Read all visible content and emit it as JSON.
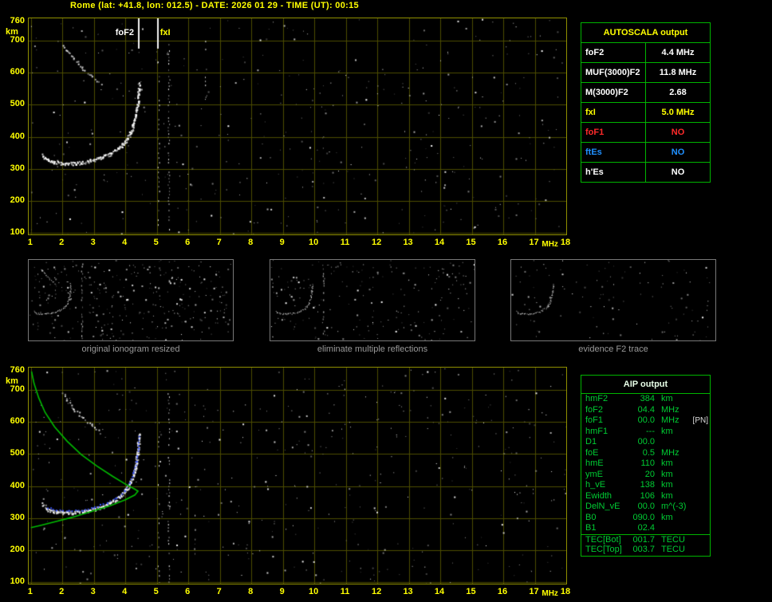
{
  "header": {
    "title": "Rome (lat: +41.8, lon: 012.5) - DATE: 2026 01 29 - TIME (UT): 00:15"
  },
  "autoscala": {
    "title": "AUTOSCALA output",
    "rows": [
      {
        "param": "foF2",
        "value": "4.4 MHz",
        "color": "#ffffff"
      },
      {
        "param": "MUF(3000)F2",
        "value": "11.8 MHz",
        "color": "#ffffff"
      },
      {
        "param": "M(3000)F2",
        "value": "2.68",
        "color": "#ffffff"
      },
      {
        "param": "fxI",
        "value": "5.0 MHz",
        "color": "#ffff00"
      },
      {
        "param": "foF1",
        "value": "NO",
        "color": "#ff2a2a"
      },
      {
        "param": "ftEs",
        "value": "NO",
        "color": "#2090ff"
      },
      {
        "param": "h'Es",
        "value": "NO",
        "color": "#ffffff"
      }
    ]
  },
  "panels": [
    {
      "caption": "original ionogram resized"
    },
    {
      "caption": "eliminate multiple reflections"
    },
    {
      "caption": "evidence F2 trace"
    }
  ],
  "aip": {
    "title": "AIP output",
    "rows": [
      {
        "param": "hmF2",
        "value": "384",
        "unit": "km",
        "note": ""
      },
      {
        "param": "foF2",
        "value": "04.4",
        "unit": "MHz",
        "note": ""
      },
      {
        "param": "foF1",
        "value": "00.0",
        "unit": "MHz",
        "note": "[PN]"
      },
      {
        "param": "hmF1",
        "value": "---",
        "unit": "km",
        "note": ""
      },
      {
        "param": "D1",
        "value": "00.0",
        "unit": "",
        "note": ""
      },
      {
        "param": "foE",
        "value": "0.5",
        "unit": "MHz",
        "note": ""
      },
      {
        "param": "hmE",
        "value": "110",
        "unit": "km",
        "note": ""
      },
      {
        "param": "ymE",
        "value": "20",
        "unit": "km",
        "note": ""
      },
      {
        "param": "h_vE",
        "value": "138",
        "unit": "km",
        "note": ""
      },
      {
        "param": "Ewidth",
        "value": "106",
        "unit": "km",
        "note": ""
      },
      {
        "param": "DelN_vE",
        "value": "00.0",
        "unit": "m^(-3)",
        "note": ""
      },
      {
        "param": "B0",
        "value": "090.0",
        "unit": "km",
        "note": ""
      },
      {
        "param": "B1",
        "value": "02.4",
        "unit": "",
        "note": ""
      },
      {
        "param": "TEC[Bot]",
        "value": "001.7",
        "unit": "TECU",
        "note": "",
        "sep": true
      },
      {
        "param": "TEC[Top]",
        "value": "003.7",
        "unit": "TECU",
        "note": ""
      }
    ]
  },
  "chart_data": [
    {
      "type": "scatter",
      "name": "autoscaled ionogram",
      "title": "",
      "xlabel": "MHz",
      "ylabel": "km",
      "xlim": [
        1,
        18
      ],
      "ylim": [
        100,
        760
      ],
      "x_ticks": [
        1,
        2,
        3,
        4,
        5,
        6,
        7,
        8,
        9,
        10,
        11,
        12,
        13,
        14,
        15,
        16,
        17,
        18
      ],
      "y_ticks": [
        760,
        700,
        600,
        500,
        400,
        300,
        200,
        100
      ],
      "grid": true,
      "legend": "none",
      "markers": [
        {
          "label": "foF2",
          "freq_mhz": 4.4,
          "color": "#ffffff"
        },
        {
          "label": "fxI",
          "freq_mhz": 5.0,
          "color": "#ffff00"
        }
      ],
      "series": [
        {
          "name": "F2 trace",
          "style": "dots",
          "color": "#ffffff",
          "points": [
            [
              1.35,
              345
            ],
            [
              1.5,
              330
            ],
            [
              1.7,
              322
            ],
            [
              2.0,
              318
            ],
            [
              2.4,
              318
            ],
            [
              2.8,
              324
            ],
            [
              3.2,
              334
            ],
            [
              3.5,
              348
            ],
            [
              3.8,
              366
            ],
            [
              4.0,
              388
            ],
            [
              4.15,
              412
            ],
            [
              4.25,
              440
            ],
            [
              4.33,
              472
            ],
            [
              4.38,
              510
            ],
            [
              4.41,
              548
            ],
            [
              4.42,
              565
            ]
          ]
        },
        {
          "name": "second reflection",
          "style": "dots-faint",
          "color": "#e8e8e8",
          "points": [
            [
              2.0,
              690
            ],
            [
              2.15,
              668
            ],
            [
              2.35,
              644
            ],
            [
              2.6,
              618
            ],
            [
              2.9,
              592
            ],
            [
              3.2,
              568
            ]
          ]
        }
      ]
    },
    {
      "type": "scatter",
      "name": "ionogram with restored trace and electron density profile",
      "title": "",
      "xlabel": "MHz",
      "ylabel": "km",
      "xlim": [
        1,
        18
      ],
      "ylim": [
        100,
        760
      ],
      "x_ticks": [
        1,
        2,
        3,
        4,
        5,
        6,
        7,
        8,
        9,
        10,
        11,
        12,
        13,
        14,
        15,
        16,
        17,
        18
      ],
      "y_ticks": [
        760,
        700,
        600,
        500,
        400,
        300,
        200,
        100
      ],
      "grid": true,
      "legend": "none",
      "markers": [],
      "series": [
        {
          "name": "F2 trace",
          "style": "dots",
          "color": "#ffffff",
          "points": [
            [
              1.35,
              345
            ],
            [
              1.5,
              330
            ],
            [
              1.7,
              322
            ],
            [
              2.0,
              318
            ],
            [
              2.4,
              318
            ],
            [
              2.8,
              324
            ],
            [
              3.2,
              334
            ],
            [
              3.5,
              348
            ],
            [
              3.8,
              366
            ],
            [
              4.0,
              388
            ],
            [
              4.15,
              412
            ],
            [
              4.25,
              440
            ],
            [
              4.33,
              472
            ],
            [
              4.38,
              510
            ],
            [
              4.41,
              548
            ],
            [
              4.42,
              565
            ]
          ]
        },
        {
          "name": "second reflection",
          "style": "dots-faint",
          "color": "#e8e8e8",
          "points": [
            [
              2.0,
              690
            ],
            [
              2.15,
              668
            ],
            [
              2.35,
              644
            ],
            [
              2.6,
              618
            ],
            [
              2.9,
              592
            ],
            [
              3.2,
              568
            ]
          ]
        },
        {
          "name": "restored trace",
          "style": "dots-sparse",
          "color": "#3b55ff",
          "points": [
            [
              1.5,
              330
            ],
            [
              1.8,
              321
            ],
            [
              2.2,
              318
            ],
            [
              2.6,
              322
            ],
            [
              3.0,
              330
            ],
            [
              3.4,
              344
            ],
            [
              3.7,
              360
            ],
            [
              3.95,
              382
            ],
            [
              4.12,
              408
            ],
            [
              4.24,
              438
            ],
            [
              4.33,
              472
            ],
            [
              4.39,
              515
            ],
            [
              4.42,
              552
            ]
          ]
        },
        {
          "name": "electron density profile",
          "style": "line",
          "color": "#00bb00",
          "points": [
            [
              1.02,
              758
            ],
            [
              1.1,
              720
            ],
            [
              1.25,
              675
            ],
            [
              1.45,
              630
            ],
            [
              1.75,
              585
            ],
            [
              2.15,
              540
            ],
            [
              2.6,
              498
            ],
            [
              3.1,
              462
            ],
            [
              3.6,
              430
            ],
            [
              4.0,
              406
            ],
            [
              4.3,
              390
            ],
            [
              4.4,
              384
            ],
            [
              4.3,
              372
            ],
            [
              4.0,
              357
            ],
            [
              3.5,
              338
            ],
            [
              2.9,
              320
            ],
            [
              2.3,
              302
            ],
            [
              1.75,
              288
            ],
            [
              1.3,
              277
            ],
            [
              1.0,
              270
            ]
          ]
        }
      ]
    }
  ]
}
